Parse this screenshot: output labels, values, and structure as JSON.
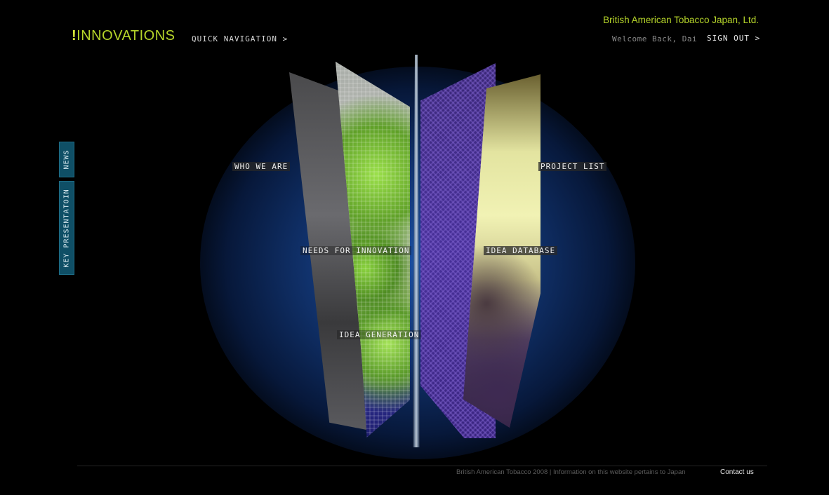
{
  "header": {
    "logo_mark": "!",
    "logo_text": "INNOVATIONS",
    "quick_nav": "QUICK NAVIGATION >",
    "company": "British American Tobacco Japan, Ltd.",
    "welcome": "Welcome Back, Dai",
    "sign_out": "SIGN OUT >"
  },
  "side_tabs": {
    "news": "NEWS",
    "key_presentation": "KEY PRESENTATOIN"
  },
  "menu": {
    "who_we_are": "WHO WE ARE",
    "project_list": "PROJECT LIST",
    "needs_for_innovation": "NEEDS FOR INNOVATION",
    "idea_database": "IDEA DATABASE",
    "idea_generation": "IDEA GENERATION"
  },
  "footer": {
    "info": "British American Tobacco 2008 | Information on this website pertains to Japan",
    "contact": "Contact us"
  },
  "colors": {
    "brand_green": "#b6d52a",
    "tab_teal": "#0f4f66",
    "background": "#000000"
  }
}
